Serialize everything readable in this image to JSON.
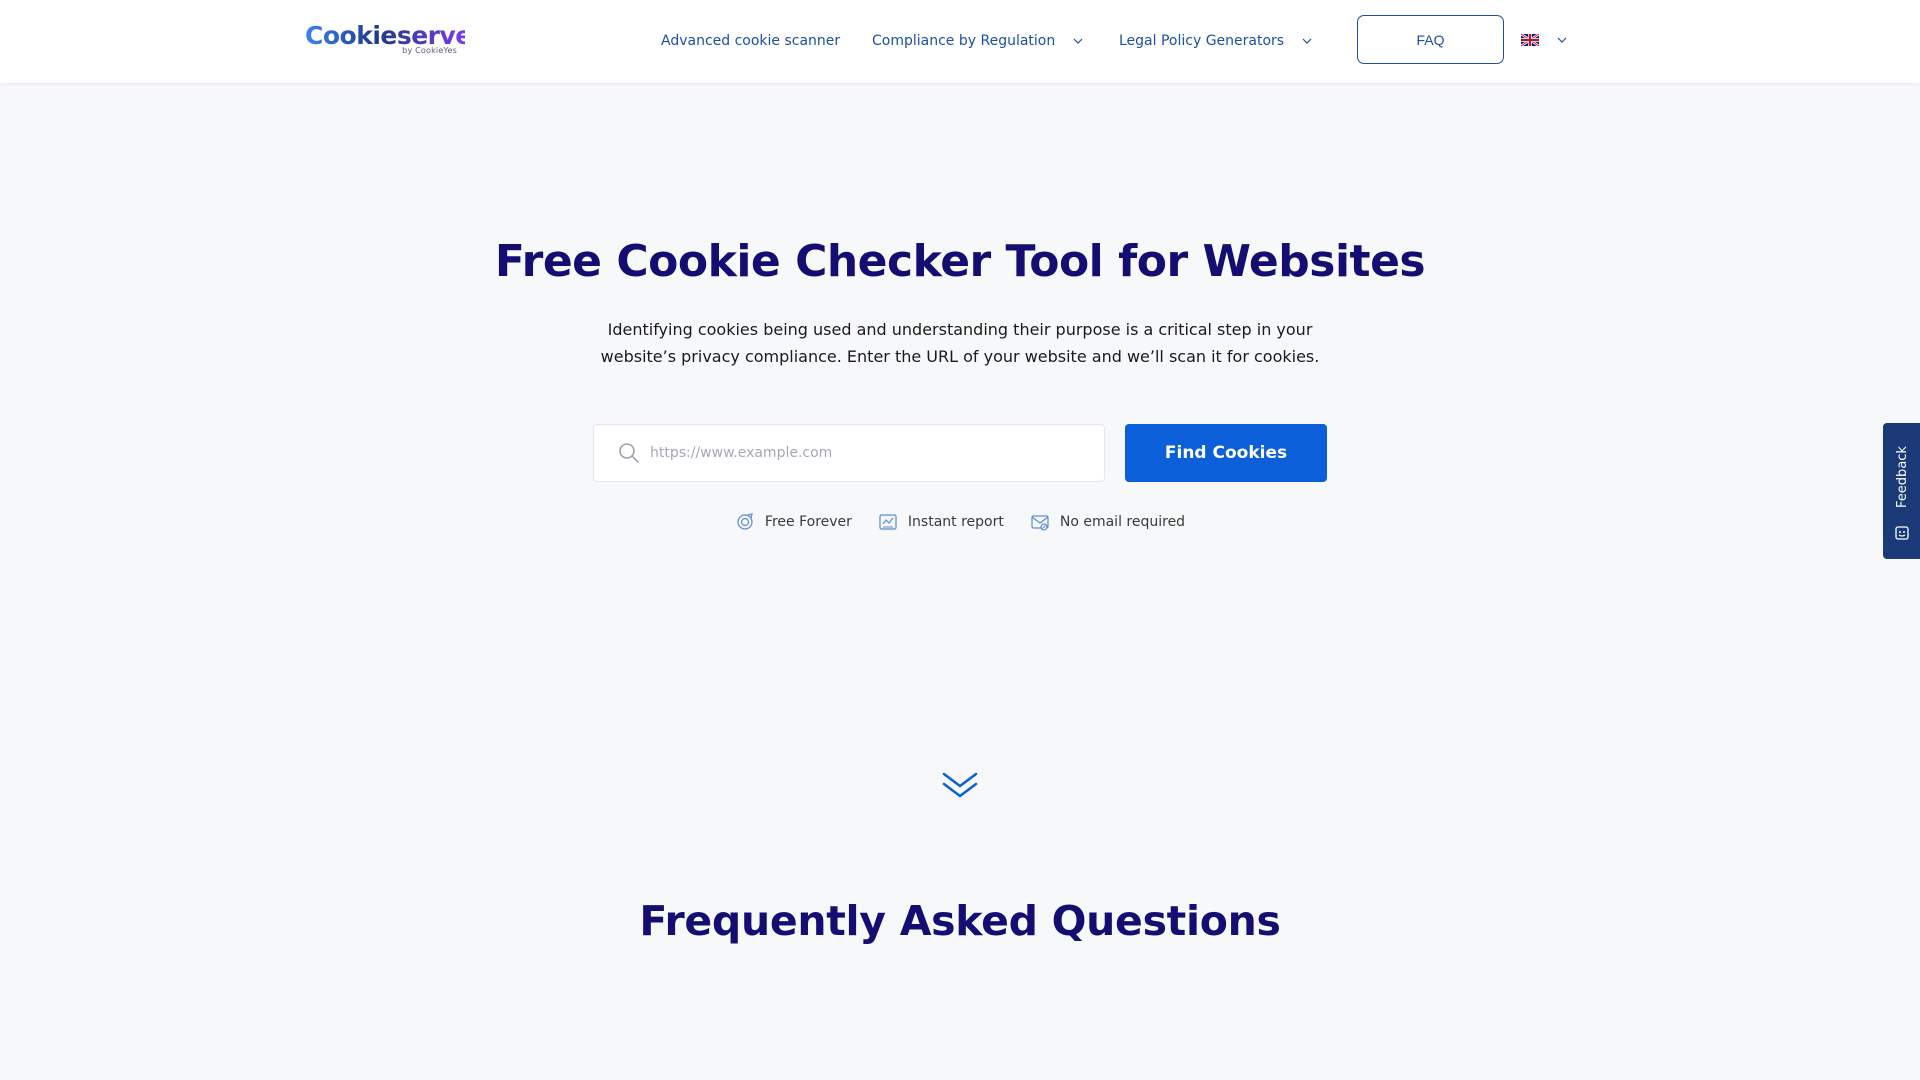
{
  "header": {
    "logo_main": "Cookieserve",
    "logo_sub": "by CookieYes",
    "nav": [
      {
        "label": "Advanced cookie scanner",
        "has_dropdown": false
      },
      {
        "label": "Compliance by Regulation",
        "has_dropdown": true
      },
      {
        "label": "Legal Policy Generators",
        "has_dropdown": true
      }
    ],
    "faq_label": "FAQ",
    "language_icon": "uk-flag-icon"
  },
  "hero": {
    "title": "Free Cookie Checker Tool for Websites",
    "description": "Identifying cookies being used and understanding their purpose is a critical step in your website’s privacy compliance. Enter the URL of your website and we’ll scan it for cookies.",
    "search": {
      "placeholder": "https://www.example.com",
      "value": ""
    },
    "button_label": "Find Cookies",
    "features": [
      {
        "label": "Free Forever",
        "icon": "badge-icon"
      },
      {
        "label": "Instant report",
        "icon": "report-icon"
      },
      {
        "label": "No email required",
        "icon": "email-icon"
      }
    ]
  },
  "faq": {
    "title": "Frequently Asked Questions"
  },
  "feedback": {
    "label": "Feedback"
  },
  "colors": {
    "brand_dark": "#150e72",
    "accent_blue": "#0b5fd8",
    "nav_blue": "#1d4fa8",
    "feedback_bg": "#1c3a78",
    "page_bg": "#f7f8fa"
  }
}
